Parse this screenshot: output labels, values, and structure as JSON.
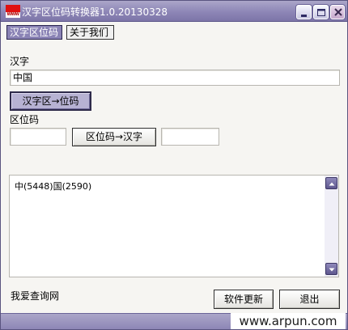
{
  "window": {
    "title": "汉字区位码转换器1.0.20130328",
    "icon_text": "WWW"
  },
  "menu": {
    "hanzi_quweima": "汉字区位码",
    "about_us": "关于我们"
  },
  "hanzi_section": {
    "label": "汉字",
    "input_value": "中国",
    "convert_button": "汉字区→位码"
  },
  "quweima_section": {
    "label": "区位码",
    "input_value": "",
    "convert_button": "区位码→汉字",
    "output_value": ""
  },
  "result": {
    "text": "中(5448)国(2590)"
  },
  "footer": {
    "site_text": "我爱查询网",
    "update_button": "软件更新",
    "exit_button": "退出",
    "watermark": "www.arpun.com"
  },
  "colors": {
    "titlebar": "#8d86b6",
    "accent_purple": "#8a83b5",
    "scroll_arrow": "#5e578e"
  },
  "icons": [
    "app-flag-icon",
    "minimize-icon",
    "maximize-icon",
    "close-icon",
    "scroll-up-icon",
    "scroll-down-icon"
  ]
}
